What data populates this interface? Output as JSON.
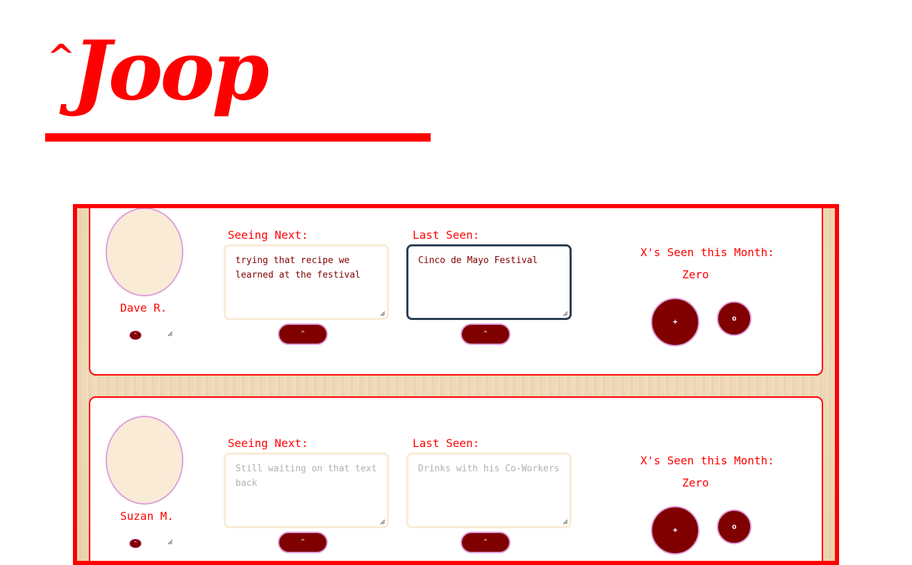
{
  "brand": {
    "caret": "^",
    "title": "Joop",
    "color": "#ff0000"
  },
  "colors": {
    "accent": "#ff0000",
    "button": "#800000",
    "button_border": "#dda0dd",
    "avatar_fill": "#faebd7",
    "active_border": "#2c3e50"
  },
  "labels": {
    "seeing_next": "Seeing Next:",
    "last_seen": "Last Seen:",
    "seen_this_month": "X's Seen this Month:"
  },
  "people": [
    {
      "name": "Dave R.",
      "seeing_next": "trying that recipe we learned at the festival",
      "seeing_next_placeholder": "",
      "last_seen": "Cinco de Mayo Festival",
      "last_seen_placeholder": "",
      "seen_count": "Zero",
      "submit_symbol": "^",
      "increment_symbol": "+",
      "reset_symbol": "o"
    },
    {
      "name": "Suzan M.",
      "seeing_next": "",
      "seeing_next_placeholder": "Still waiting on that text back",
      "last_seen": "",
      "last_seen_placeholder": "Drinks with his Co-Workers",
      "seen_count": "Zero",
      "submit_symbol": "^",
      "increment_symbol": "+",
      "reset_symbol": "o"
    }
  ]
}
